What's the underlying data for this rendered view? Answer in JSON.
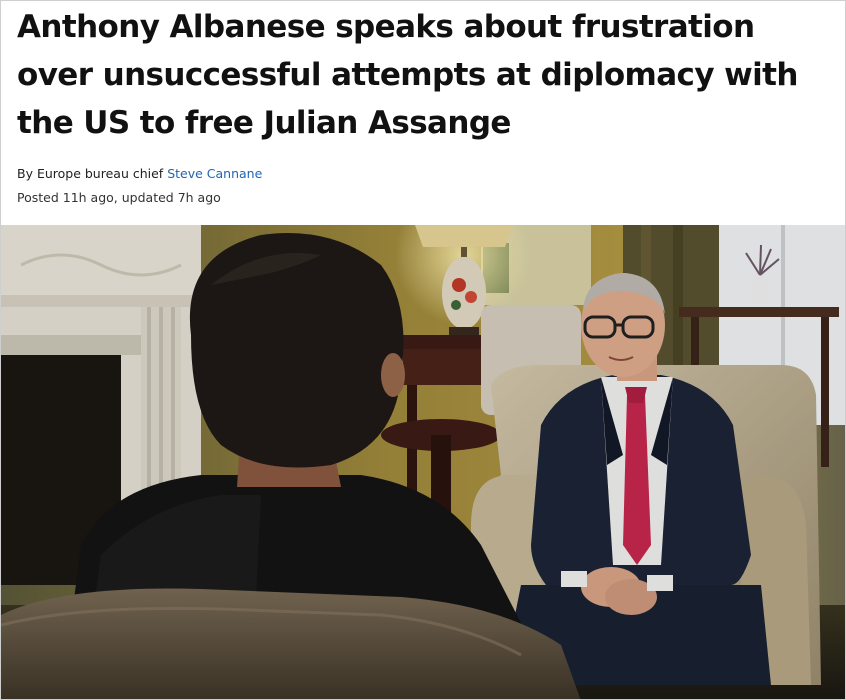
{
  "article": {
    "headline": "Anthony Albanese speaks about frustration over unsuccessful attempts at diplomacy with the US to free Julian Assange",
    "byline_prefix": "By Europe bureau chief ",
    "author": "Steve Cannane",
    "posted": "Posted 11h ago, updated 7h ago"
  },
  "image": {
    "subject": "interview-photo"
  },
  "colors": {
    "link": "#2165b0",
    "tie": "#c8284f",
    "suit": "#1c2438"
  }
}
